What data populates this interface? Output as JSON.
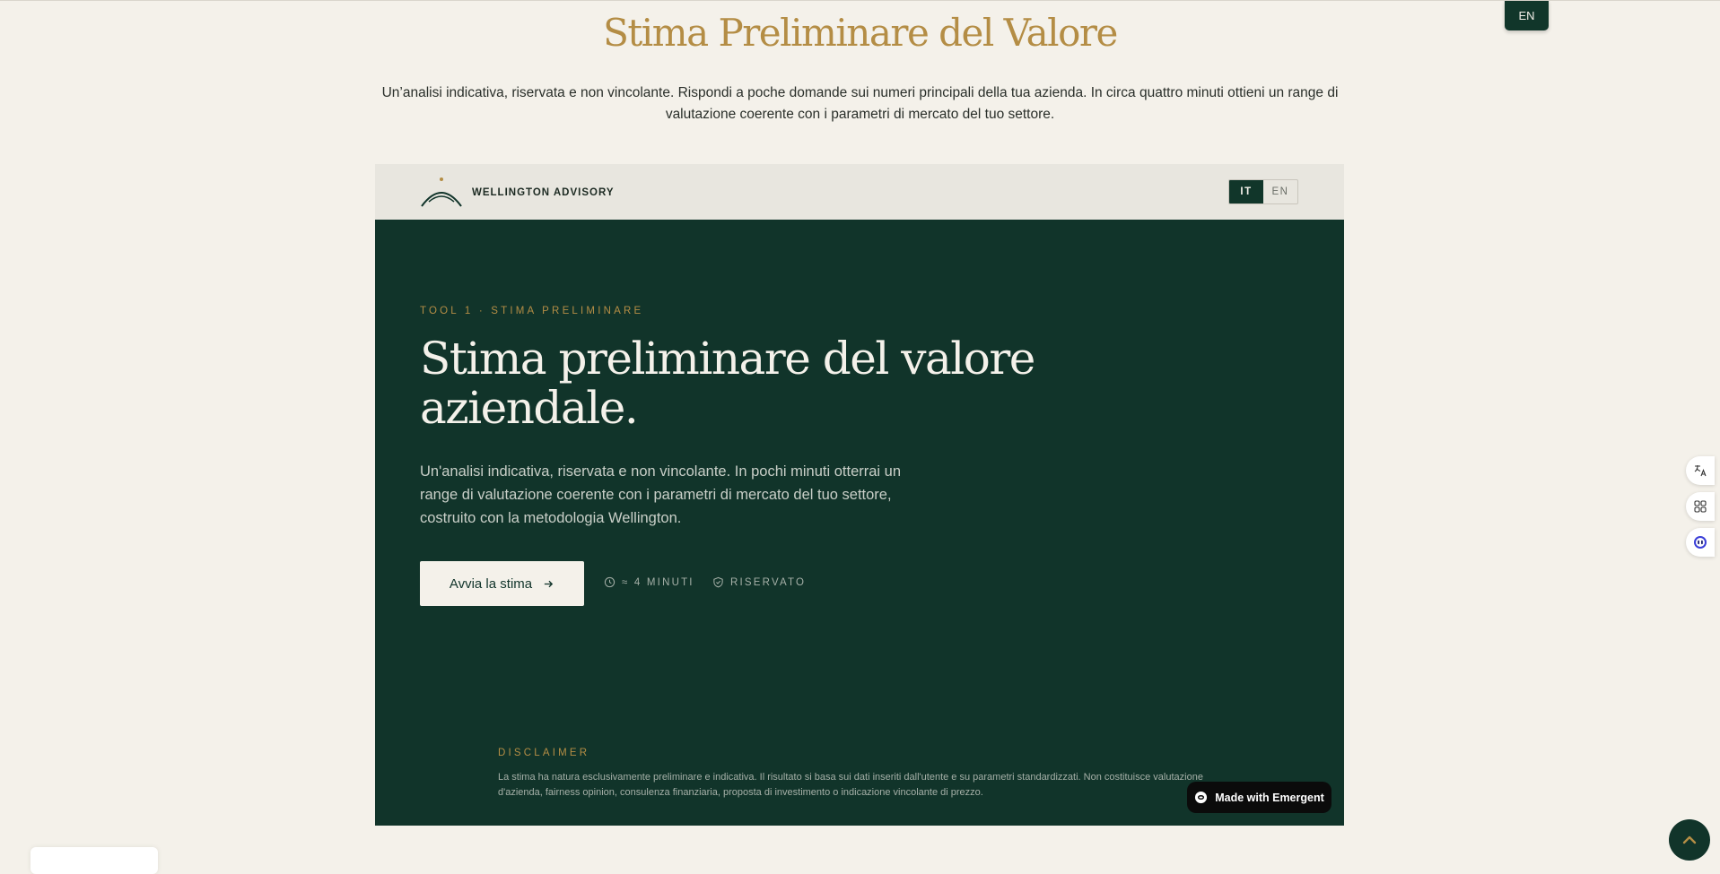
{
  "top_language_button": "EN",
  "hero": {
    "title": "Stima Preliminare del Valore",
    "subtitle": "Un’analisi indicativa, riservata e non vincolante. Rispondi a poche domande sui numeri principali della tua azienda. In circa quattro minuti ottieni un range di valutazione coerente con i parametri di mercato del tuo settore."
  },
  "embed": {
    "brand_name": "WELLINGTON ADVISORY",
    "language_switch": {
      "it": "IT",
      "en": "EN",
      "active": "IT"
    },
    "eyebrow": "TOOL 1 · STIMA PRELIMINARE",
    "title_line1": "Stima preliminare del valore",
    "title_line2": "aziendale.",
    "description": "Un'analisi indicativa, riservata e non vincolante. In pochi minuti otterrai un range di valutazione coerente con i parametri di mercato del tuo settore, costruito con la metodologia Wellington.",
    "cta_label": "Avvia la stima",
    "meta_duration": "≈ 4 MINUTI",
    "meta_private": "RISERVATO",
    "disclaimer_label": "DISCLAIMER",
    "disclaimer_text": "La stima ha natura esclusivamente preliminare e indicativa. Il risultato si basa sui dati inseriti dall'utente e su parametri standardizzati. Non costituisce valutazione d'azienda, fairness opinion, consulenza finanziaria, proposta di investimento o indicazione vincolante di prezzo."
  },
  "badge": {
    "label": "Made with Emergent"
  },
  "colors": {
    "page_background": "#f4f1ea",
    "brand_green": "#11342a",
    "gold_accent": "#b48d45",
    "header_band": "#e8e6df"
  },
  "icons": {
    "side_tools": [
      "translate-icon",
      "apps-icon",
      "assistant-icon"
    ],
    "scroll_top": "chevron-up-icon"
  }
}
